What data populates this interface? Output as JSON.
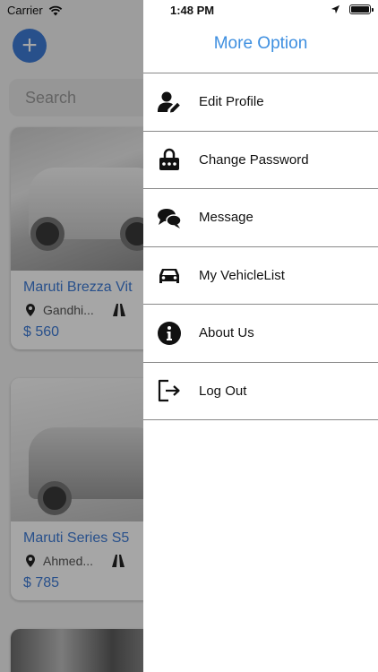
{
  "status": {
    "carrier": "Carrier",
    "time": "1:48 PM"
  },
  "background": {
    "add_button": "+",
    "search_placeholder": "Search",
    "cards": [
      {
        "title": "Maruti Brezza Vit",
        "location": "Gandhi...",
        "price": "$ 560"
      },
      {
        "title": "Maruti Series S5",
        "location": "Ahmed...",
        "price": "$ 785"
      }
    ]
  },
  "drawer": {
    "title": "More Option",
    "items": [
      {
        "label": "Edit Profile",
        "icon": "edit-profile-icon"
      },
      {
        "label": "Change Password",
        "icon": "lock-icon"
      },
      {
        "label": "Message",
        "icon": "chat-icon"
      },
      {
        "label": "My VehicleList",
        "icon": "car-icon"
      },
      {
        "label": "About Us",
        "icon": "info-icon"
      },
      {
        "label": "Log Out",
        "icon": "logout-icon"
      }
    ]
  },
  "colors": {
    "accent": "#3e7bd6",
    "title": "#3e8fe0",
    "divider": "#888888"
  }
}
